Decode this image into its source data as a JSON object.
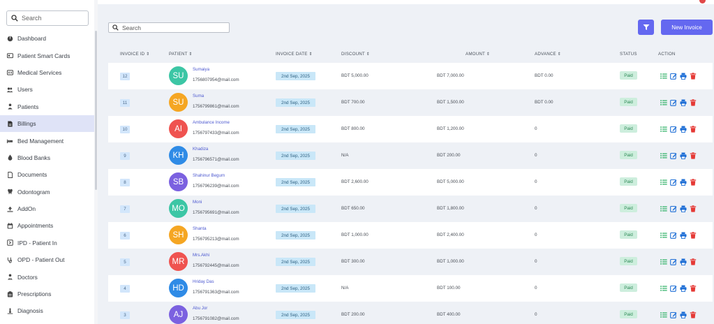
{
  "sidebar": {
    "search_placeholder": "Search",
    "items": [
      {
        "label": "Dashboard",
        "icon": "dashboard-icon"
      },
      {
        "label": "Patient Smart Cards",
        "icon": "id-card-icon"
      },
      {
        "label": "Medical Services",
        "icon": "medical-services-icon"
      },
      {
        "label": "Users",
        "icon": "users-icon"
      },
      {
        "label": "Patients",
        "icon": "patient-icon"
      },
      {
        "label": "Billings",
        "icon": "billing-icon",
        "active": true
      },
      {
        "label": "Bed Management",
        "icon": "bed-icon"
      },
      {
        "label": "Blood Banks",
        "icon": "blood-drop-icon"
      },
      {
        "label": "Documents",
        "icon": "documents-icon"
      },
      {
        "label": "Odontogram",
        "icon": "tooth-icon"
      },
      {
        "label": "AddOn",
        "icon": "upload-icon"
      },
      {
        "label": "Appointments",
        "icon": "calendar-icon"
      },
      {
        "label": "IPD - Patient In",
        "icon": "ipd-icon"
      },
      {
        "label": "OPD - Patient Out",
        "icon": "stethoscope-icon"
      },
      {
        "label": "Doctors",
        "icon": "doctor-icon"
      },
      {
        "label": "Prescriptions",
        "icon": "prescription-icon"
      },
      {
        "label": "Diagnosis",
        "icon": "diagnosis-icon"
      }
    ]
  },
  "toolbar": {
    "search_placeholder": "Search",
    "new_invoice_label": "New Invoice",
    "accent_color": "#6468f0"
  },
  "table": {
    "headers": {
      "invoice_id": "INVOICE ID",
      "patient": "PATIENT",
      "invoice_date": "INVOICE DATE",
      "discount": "DISCOUNT",
      "amount": "AMOUNT",
      "advance": "ADVANCE",
      "status": "STATUS",
      "action": "ACTION"
    },
    "rows": [
      {
        "id": "12",
        "initials": "SU",
        "avatar_color": "#3cc6a5",
        "name": "Sumaiya",
        "email": "1756807954@mail.com",
        "date": "2nd Sep, 2025",
        "discount": "BDT 5,000.00",
        "amount": "BDT 7,000.00",
        "advance": "BDT 0.00",
        "status": "Paid"
      },
      {
        "id": "11",
        "initials": "SU",
        "avatar_color": "#f5a623",
        "name": "Suma",
        "email": "1756799861@mail.com",
        "date": "2nd Sep, 2025",
        "discount": "BDT 700.00",
        "amount": "BDT 1,500.00",
        "advance": "BDT 0.00",
        "status": "Paid"
      },
      {
        "id": "10",
        "initials": "AI",
        "avatar_color": "#ef5350",
        "name": "Ambulance Income",
        "email": "1756797433@mail.com",
        "date": "2nd Sep, 2025",
        "discount": "BDT 800.00",
        "amount": "BDT 1,200.00",
        "advance": "0",
        "status": "Paid"
      },
      {
        "id": "9",
        "initials": "KH",
        "avatar_color": "#2f8be6",
        "name": "Khadiza",
        "email": "1756796571@mail.com",
        "date": "2nd Sep, 2025",
        "discount": "N/A",
        "amount": "BDT 200.00",
        "advance": "0",
        "status": "Paid"
      },
      {
        "id": "8",
        "initials": "SB",
        "avatar_color": "#7b61e0",
        "name": "Shahinur Begum",
        "email": "1756796239@mail.com",
        "date": "2nd Sep, 2025",
        "discount": "BDT 2,600.00",
        "amount": "BDT 5,000.00",
        "advance": "0",
        "status": "Paid"
      },
      {
        "id": "7",
        "initials": "MO",
        "avatar_color": "#3cc6a5",
        "name": "Moni",
        "email": "1756795691@mail.com",
        "date": "2nd Sep, 2025",
        "discount": "BDT 650.00",
        "amount": "BDT 1,800.00",
        "advance": "0",
        "status": "Paid"
      },
      {
        "id": "6",
        "initials": "SH",
        "avatar_color": "#f5a623",
        "name": "Shanta",
        "email": "1756795213@mail.com",
        "date": "2nd Sep, 2025",
        "discount": "BDT 1,000.00",
        "amount": "BDT 2,400.00",
        "advance": "0",
        "status": "Paid"
      },
      {
        "id": "5",
        "initials": "MR",
        "avatar_color": "#ef5350",
        "name": "Mrs.Akhi",
        "email": "1756792445@mail.com",
        "date": "2nd Sep, 2025",
        "discount": "BDT 300.00",
        "amount": "BDT 1,000.00",
        "advance": "0",
        "status": "Paid"
      },
      {
        "id": "4",
        "initials": "HD",
        "avatar_color": "#2f8be6",
        "name": "Hriday Das",
        "email": "1756791363@mail.com",
        "date": "2nd Sep, 2025",
        "discount": "N/A",
        "amount": "BDT 100.00",
        "advance": "0",
        "status": "Paid"
      },
      {
        "id": "3",
        "initials": "AJ",
        "avatar_color": "#7b61e0",
        "name": "Abu Jor",
        "email": "1756791082@mail.com",
        "date": "2nd Sep, 2025",
        "discount": "BDT 200.00",
        "amount": "BDT 400.00",
        "advance": "0",
        "status": "Paid"
      }
    ]
  },
  "action_icons": [
    "list-icon",
    "edit-icon",
    "print-icon",
    "trash-icon"
  ],
  "colors": {
    "view": "#27ae60",
    "edit": "#1f6fd6",
    "print": "#1f6fd6",
    "delete": "#e53935"
  }
}
